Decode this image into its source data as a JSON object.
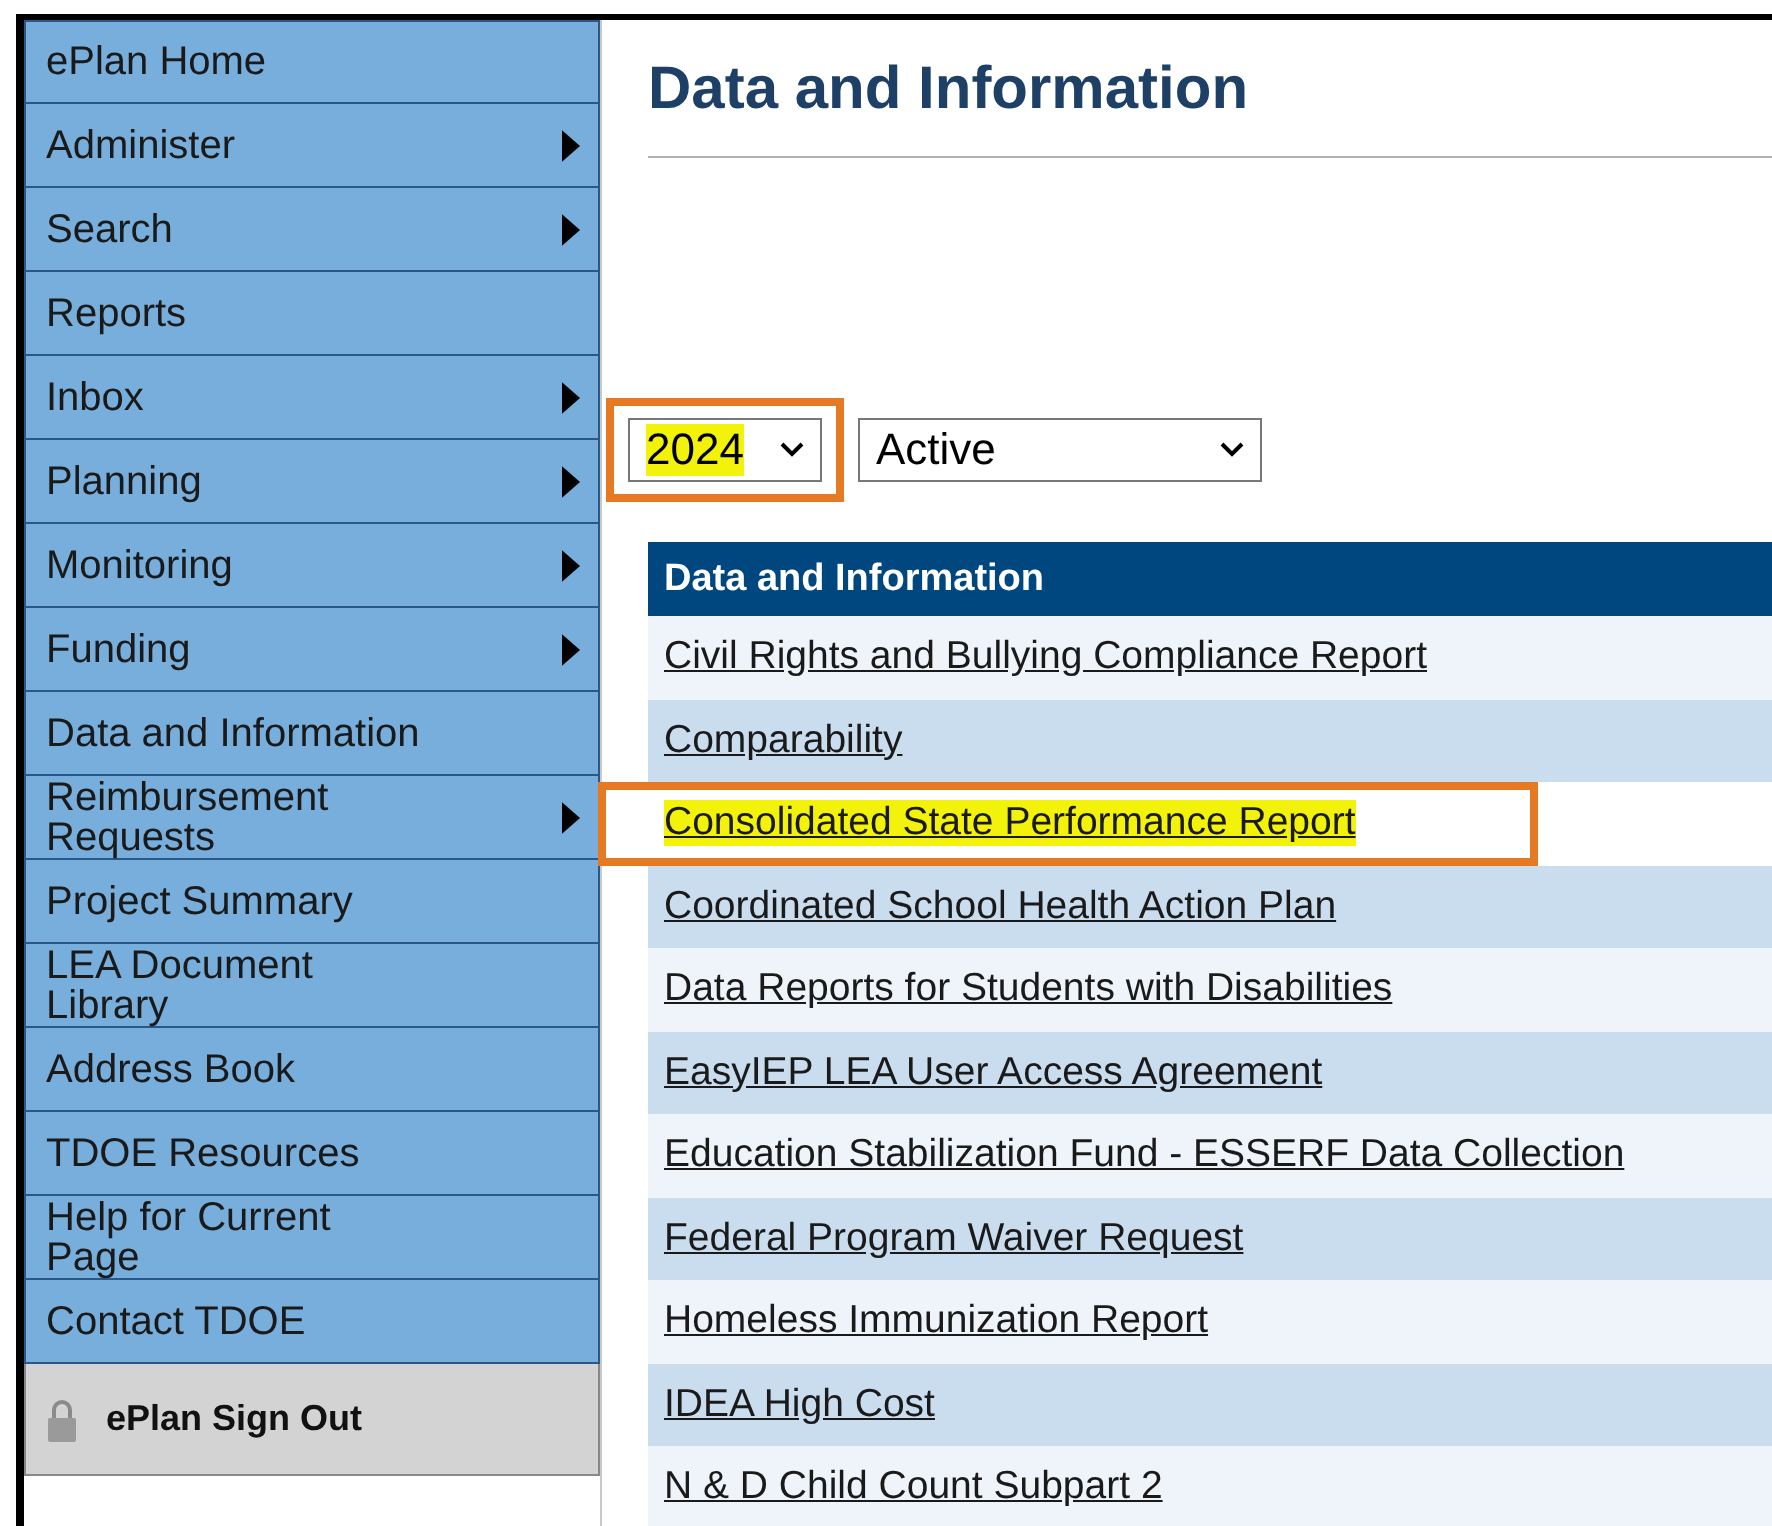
{
  "sidebar": {
    "items": [
      {
        "label": "ePlan Home",
        "has_submenu": false
      },
      {
        "label": "Administer",
        "has_submenu": true
      },
      {
        "label": "Search",
        "has_submenu": true
      },
      {
        "label": "Reports",
        "has_submenu": false
      },
      {
        "label": "Inbox",
        "has_submenu": true
      },
      {
        "label": "Planning",
        "has_submenu": true
      },
      {
        "label": "Monitoring",
        "has_submenu": true
      },
      {
        "label": "Funding",
        "has_submenu": true
      },
      {
        "label": "Data and Information",
        "has_submenu": false
      },
      {
        "label": "Reimbursement Requests",
        "has_submenu": true
      },
      {
        "label": "Project Summary",
        "has_submenu": false
      },
      {
        "label": "LEA Document Library",
        "has_submenu": false
      },
      {
        "label": "Address Book",
        "has_submenu": false
      },
      {
        "label": "TDOE Resources",
        "has_submenu": false
      },
      {
        "label": "Help for Current Page",
        "has_submenu": false
      },
      {
        "label": "Contact TDOE",
        "has_submenu": false
      }
    ],
    "sign_out": {
      "label": "ePlan Sign Out"
    }
  },
  "page_title": "Data and Information",
  "filters": [
    {
      "value": "2024",
      "highlighted": true
    },
    {
      "value": "Active",
      "highlighted": false
    }
  ],
  "table": {
    "header": "Data and Information",
    "rows": [
      {
        "label": "Civil Rights and Bullying Compliance Report",
        "highlighted": false
      },
      {
        "label": "Comparability",
        "highlighted": false
      },
      {
        "label": "Consolidated State Performance Report",
        "highlighted": true
      },
      {
        "label": "Coordinated School Health Action Plan",
        "highlighted": false
      },
      {
        "label": "Data Reports for Students with Disabilities",
        "highlighted": false
      },
      {
        "label": "EasyIEP LEA User Access Agreement",
        "highlighted": false
      },
      {
        "label": "Education Stabilization Fund - ESSERF Data Collection",
        "highlighted": false
      },
      {
        "label": "Federal Program Waiver Request",
        "highlighted": false
      },
      {
        "label": "Homeless Immunization Report",
        "highlighted": false
      },
      {
        "label": "IDEA High Cost",
        "highlighted": false
      },
      {
        "label": "N & D Child Count Subpart 2",
        "highlighted": false
      }
    ]
  }
}
